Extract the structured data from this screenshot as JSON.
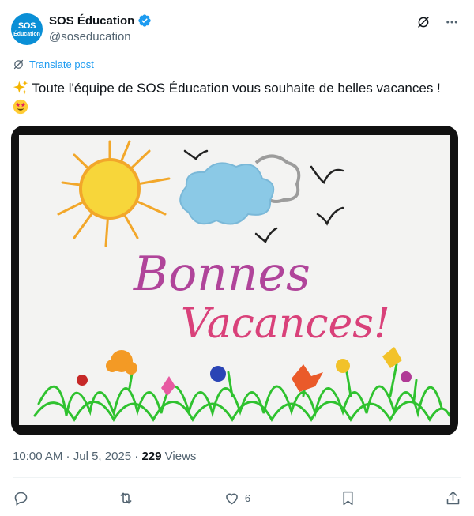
{
  "author": {
    "avatar_line1": "SOS",
    "avatar_line2": "Éducation",
    "name": "SOS Éducation",
    "handle": "@soseducation"
  },
  "translate_label": "Translate post",
  "tweet": {
    "text": "Toute l'équipe de SOS Éducation vous souhaite de belles vacances !"
  },
  "media": {
    "line1": "Bonnes",
    "line2": "Vacances!"
  },
  "meta": {
    "time": "10:00 AM",
    "sep1": " · ",
    "date": "Jul 5, 2025",
    "sep2": " · ",
    "views_count": "229",
    "views_label": " Views"
  },
  "actions": {
    "likes": "6"
  },
  "colors": {
    "accent": "#1d9bf0",
    "muted": "#536471",
    "brand": "#0a8fd6"
  }
}
